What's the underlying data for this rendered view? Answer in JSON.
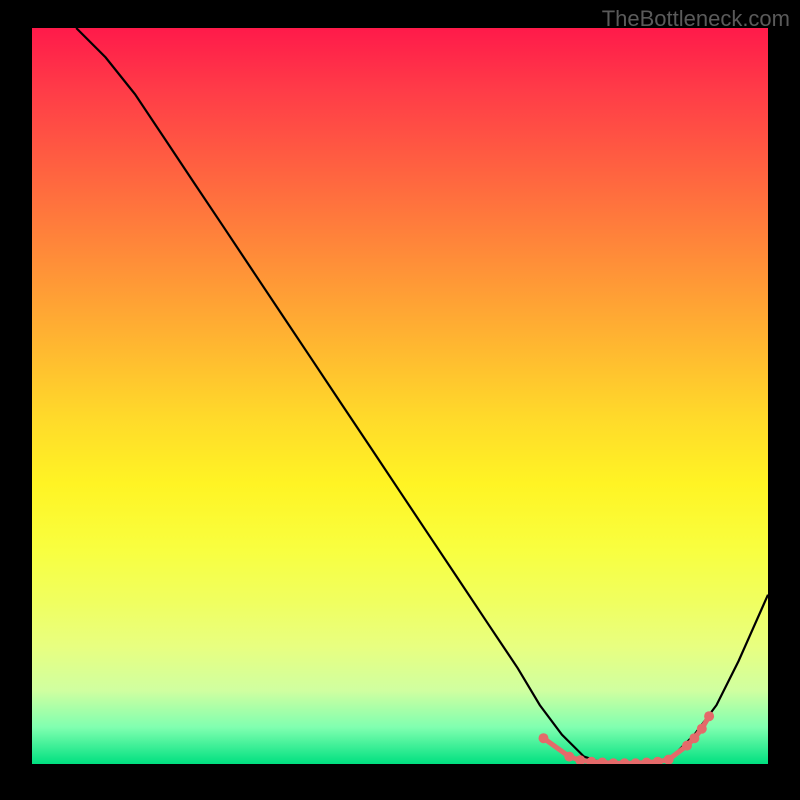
{
  "watermark": "TheBottleneck.com",
  "chart_data": {
    "type": "line",
    "title": "",
    "xlabel": "",
    "ylabel": "",
    "xlim": [
      0,
      100
    ],
    "ylim": [
      0,
      100
    ],
    "series": [
      {
        "name": "curve",
        "x": [
          6,
          10,
          14,
          18,
          22,
          26,
          30,
          34,
          38,
          42,
          46,
          50,
          54,
          58,
          62,
          66,
          69,
          72,
          75,
          78,
          81,
          84,
          87,
          90,
          93,
          96,
          100
        ],
        "y": [
          100,
          96,
          91,
          85,
          79,
          73,
          67,
          61,
          55,
          49,
          43,
          37,
          31,
          25,
          19,
          13,
          8,
          4,
          1,
          0,
          0,
          0,
          1,
          4,
          8,
          14,
          23
        ]
      }
    ],
    "highlight_points": {
      "name": "coral-dots",
      "x": [
        69.5,
        73,
        74.5,
        76,
        77.5,
        79,
        80.5,
        82,
        83.5,
        85,
        86.5,
        89,
        90,
        91,
        92
      ],
      "y": [
        3.5,
        1,
        0.5,
        0.3,
        0.2,
        0.1,
        0.1,
        0.1,
        0.2,
        0.3,
        0.6,
        2.5,
        3.5,
        4.8,
        6.5
      ]
    },
    "gradient_colors": {
      "top": "#ff1a4a",
      "mid_upper": "#ff9a36",
      "mid": "#fff424",
      "mid_lower": "#e8ff80",
      "bottom": "#00e080"
    }
  }
}
